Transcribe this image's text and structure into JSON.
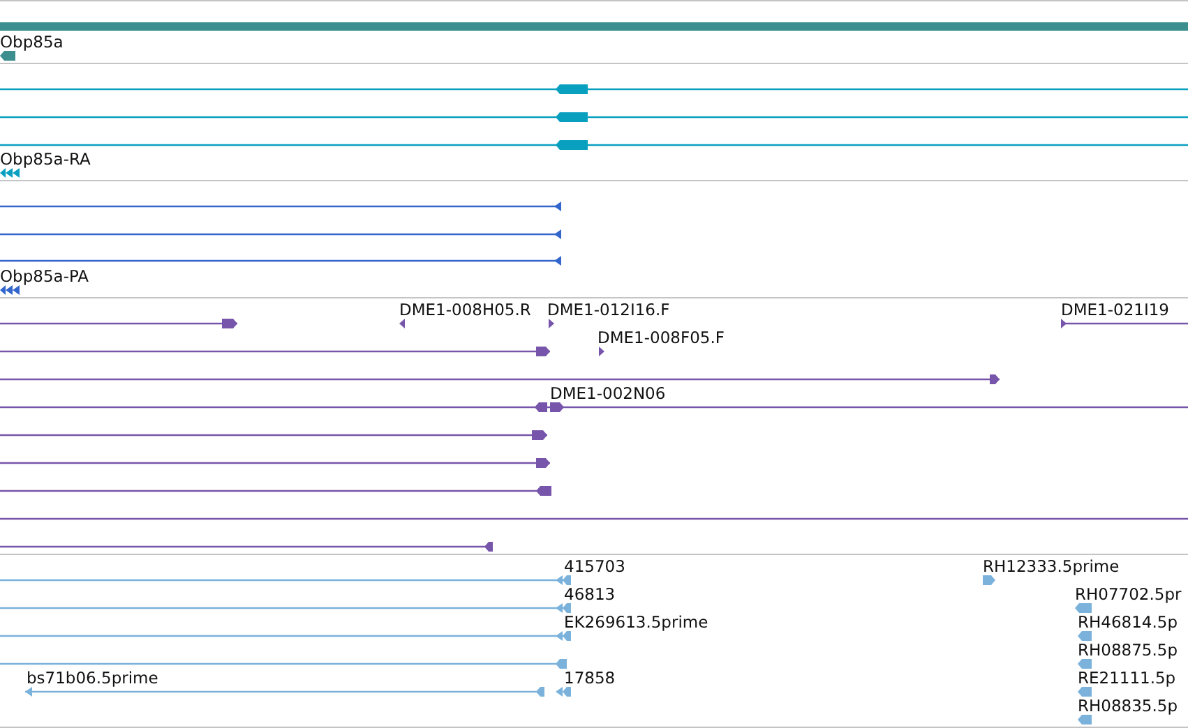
{
  "tracks": [
    {
      "color": "#3d8f8f",
      "labels": [
        "Obp85a"
      ]
    },
    {
      "color": "#09a0c0",
      "labels": [
        "Obp85a-RA"
      ]
    },
    {
      "color": "#3366cc",
      "labels": [
        "Obp85a-PA"
      ]
    },
    {
      "color": "#7755aa",
      "labels": [
        "DME1-008H05.R",
        "DME1-012I16.F",
        "DME1-021I19",
        "DME1-008F05.F",
        "DME1-002N06"
      ]
    },
    {
      "color": "#7ab2dc",
      "labels": [
        "415703",
        "RH12333.5prime",
        "46813",
        "RH07702.5pr",
        "EK269613.5prime",
        "RH46814.5p",
        "RH08875.5p",
        "bs71b06.5prime",
        "17858",
        "RE21111.5p",
        "RH08835.5p"
      ]
    }
  ]
}
